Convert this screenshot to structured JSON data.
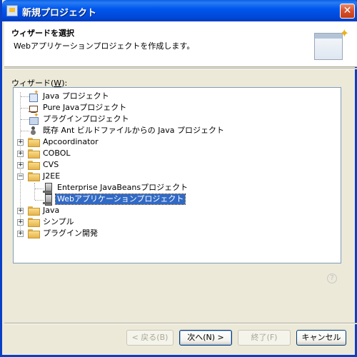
{
  "window": {
    "title": "新規プロジェクト",
    "close_glyph": "✕"
  },
  "banner": {
    "title": "ウィザードを選択",
    "description": "Webアプリケーションプロジェクトを作成します。"
  },
  "wizard_label": {
    "text": "ウィザード(",
    "accel": "W",
    "suffix": "):"
  },
  "tree": {
    "items": [
      {
        "label": "Java プロジェクト"
      },
      {
        "label": "Pure Javaプロジェクト"
      },
      {
        "label": "プラグインプロジェクト"
      },
      {
        "label": "既存 Ant ビルドファイルからの Java プロジェクト"
      },
      {
        "label": "Apcoordinator"
      },
      {
        "label": "COBOL"
      },
      {
        "label": "CVS"
      },
      {
        "label": "J2EE"
      },
      {
        "label": "Enterprise JavaBeansプロジェクト"
      },
      {
        "label": "Webアプリケーションプロジェクト"
      },
      {
        "label": "Java"
      },
      {
        "label": "シンプル"
      },
      {
        "label": "プラグイン開発"
      }
    ],
    "expand_plus": "+",
    "expand_minus": "−"
  },
  "help": {
    "glyph": "?"
  },
  "buttons": {
    "back": "< 戻る(B)",
    "next": "次へ(N) >",
    "finish": "終了(F)",
    "cancel": "キャンセル"
  },
  "colors": {
    "title_bar": "#0058ee",
    "selection": "#316ac5",
    "face": "#ece9d8"
  }
}
